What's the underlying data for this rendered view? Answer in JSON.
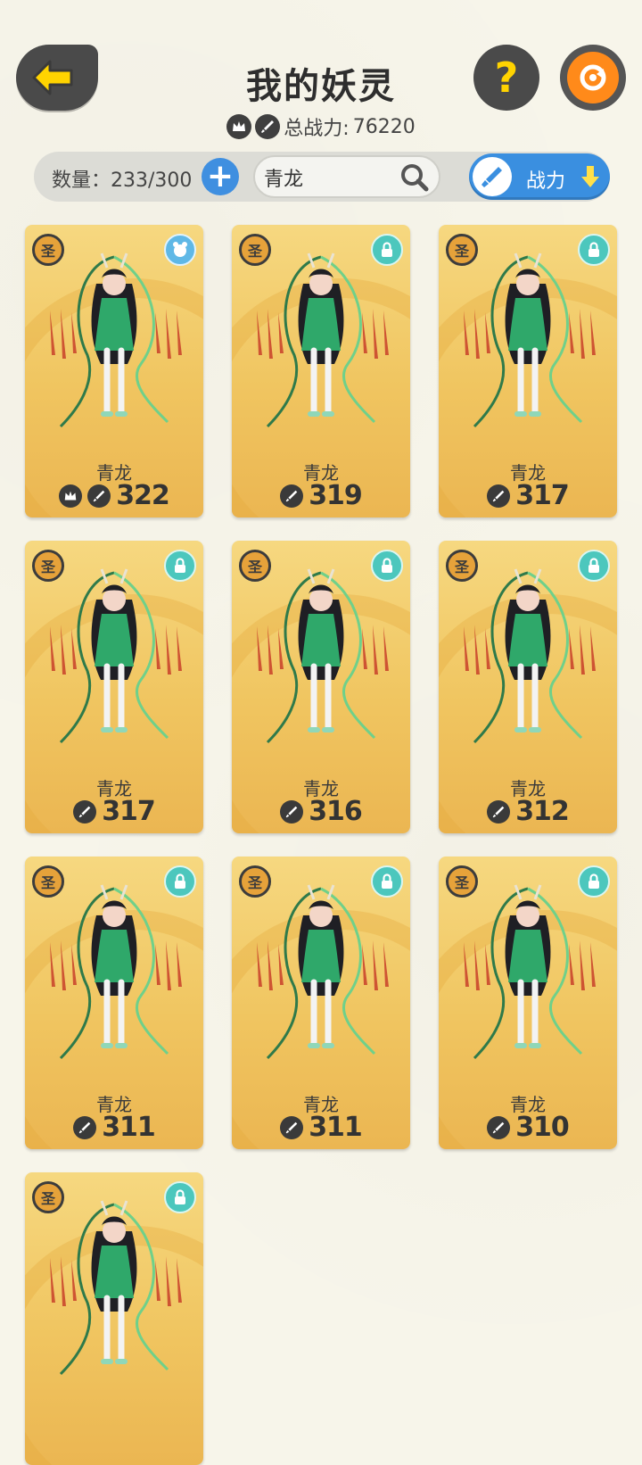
{
  "header": {
    "title": "我的妖灵",
    "total_power_label": "总战力:",
    "total_power_value": "76220"
  },
  "toolbar": {
    "count_label": "数量：233/300",
    "search_value": "青龙",
    "sort_label": "战力"
  },
  "cards": [
    {
      "name": "青龙",
      "power": "322",
      "badge": "圣",
      "has_crown": true,
      "corner": "pet"
    },
    {
      "name": "青龙",
      "power": "319",
      "badge": "圣",
      "has_crown": false,
      "corner": "lock"
    },
    {
      "name": "青龙",
      "power": "317",
      "badge": "圣",
      "has_crown": false,
      "corner": "lock"
    },
    {
      "name": "青龙",
      "power": "317",
      "badge": "圣",
      "has_crown": false,
      "corner": "lock"
    },
    {
      "name": "青龙",
      "power": "316",
      "badge": "圣",
      "has_crown": false,
      "corner": "lock"
    },
    {
      "name": "青龙",
      "power": "312",
      "badge": "圣",
      "has_crown": false,
      "corner": "lock"
    },
    {
      "name": "青龙",
      "power": "311",
      "badge": "圣",
      "has_crown": false,
      "corner": "lock"
    },
    {
      "name": "青龙",
      "power": "311",
      "badge": "圣",
      "has_crown": false,
      "corner": "lock"
    },
    {
      "name": "青龙",
      "power": "310",
      "badge": "圣",
      "has_crown": false,
      "corner": "lock"
    },
    {
      "name": "",
      "power": "",
      "badge": "圣",
      "has_crown": false,
      "corner": "lock"
    }
  ],
  "colors": {
    "accent_blue": "#3a8fe0",
    "card_gold": "#f0c560",
    "lock_teal": "#4cc7bd",
    "yellow_icon": "#ffd300",
    "orange": "#ff8a1a"
  }
}
